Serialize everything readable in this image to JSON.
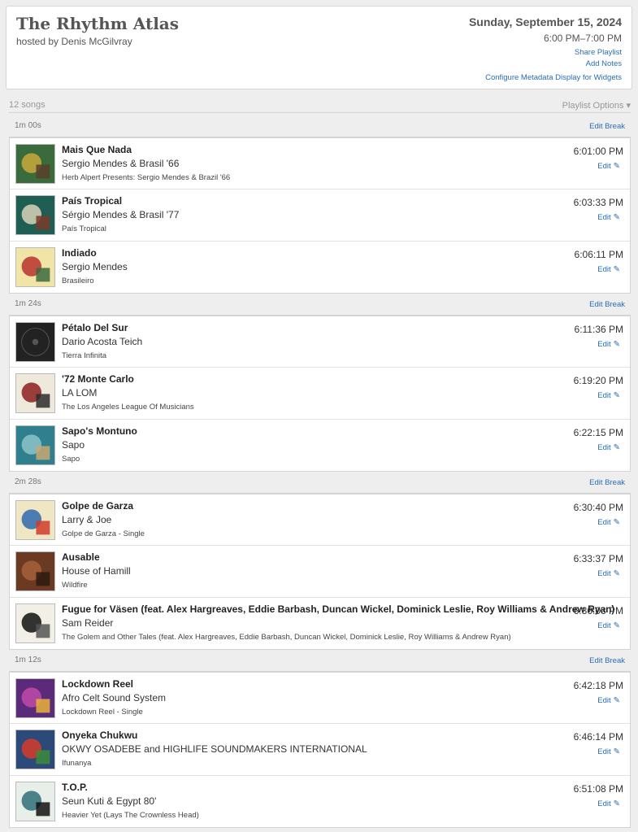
{
  "header": {
    "title": "The Rhythm Atlas",
    "host": "hosted by Denis McGilvray",
    "date": "Sunday, September 15, 2024",
    "time_range": "6:00 PM–7:00 PM",
    "links": {
      "share": "Share Playlist",
      "notes": "Add Notes",
      "config": "Configure Metadata Display for Widgets"
    }
  },
  "playlist": {
    "count_label": "12 songs",
    "options_label": "Playlist Options ▾",
    "edit_label": "Edit",
    "edit_break_label": "Edit Break"
  },
  "breaks": [
    {
      "duration": "1m 00s"
    },
    {
      "duration": "1m 24s"
    },
    {
      "duration": "2m 28s"
    },
    {
      "duration": "1m 12s"
    }
  ],
  "songs": [
    {
      "title": "Mais Que Nada",
      "artist": "Sergio Mendes & Brasil '66",
      "album": "Herb Alpert Presents: Sergio Mendes & Brazil '66",
      "time": "6:01:00 PM",
      "art_colors": [
        "#3a6b3d",
        "#c9a93a",
        "#5a3e2a"
      ]
    },
    {
      "title": "País Tropical",
      "artist": "Sérgio Mendes & Brasil '77",
      "album": "País Tropical",
      "time": "6:03:33 PM",
      "art_colors": [
        "#1f5e52",
        "#d8d2b8",
        "#7a3a2a"
      ]
    },
    {
      "title": "Indiado",
      "artist": "Sergio Mendes",
      "album": "Brasileiro",
      "time": "6:06:11 PM",
      "art_colors": [
        "#f0e4a6",
        "#b7322e",
        "#3c6a3e"
      ]
    },
    {
      "title": "Pétalo Del Sur",
      "artist": "Dario Acosta Teich",
      "album": "Tierra Infinita",
      "time": "6:11:36 PM",
      "art_colors": [
        "#222222",
        "#333333",
        "#444444"
      ]
    },
    {
      "title": "'72 Monte Carlo",
      "artist": "LA LOM",
      "album": "The Los Angeles League Of Musicians",
      "time": "6:19:20 PM",
      "art_colors": [
        "#efe9dc",
        "#8b1e1e",
        "#2b2b2b"
      ]
    },
    {
      "title": "Sapo's Montuno",
      "artist": "Sapo",
      "album": "Sapo",
      "time": "6:22:15 PM",
      "art_colors": [
        "#2f7f8f",
        "#8cc3c8",
        "#c7a872"
      ]
    },
    {
      "title": "Golpe de Garza",
      "artist": "Larry & Joe",
      "album": "Golpe de Garza - Single",
      "time": "6:30:40 PM",
      "art_colors": [
        "#efe6c4",
        "#2e6ab0",
        "#d13b2b"
      ]
    },
    {
      "title": "Ausable",
      "artist": "House of Hamill",
      "album": "Wildfire",
      "time": "6:33:37 PM",
      "art_colors": [
        "#6a3a22",
        "#a4623a",
        "#2e1a10"
      ]
    },
    {
      "title": "Fugue for Väsen (feat. Alex Hargreaves, Eddie Barbash, Duncan Wickel, Dominick Leslie, Roy Williams & Andrew Ryan)",
      "artist": "Sam Reider",
      "album": "The Golem and Other Tales (feat. Alex Hargreaves, Eddie Barbash, Duncan Wickel, Dominick Leslie, Roy Williams & Andrew Ryan)",
      "time": "6:36:03 PM",
      "art_colors": [
        "#f2efe6",
        "#111111",
        "#555555"
      ]
    },
    {
      "title": "Lockdown Reel",
      "artist": "Afro Celt Sound System",
      "album": "Lockdown Reel - Single",
      "time": "6:42:18 PM",
      "art_colors": [
        "#5b2a7a",
        "#c24aa8",
        "#e8b23a"
      ]
    },
    {
      "title": "Onyeka Chukwu",
      "artist": "OKWY OSADEBE and HIGHLIFE SOUNDMAKERS INTERNATIONAL",
      "album": "Ifunanya",
      "time": "6:46:14 PM",
      "art_colors": [
        "#2b4a7a",
        "#d83a2a",
        "#3d8a3a"
      ]
    },
    {
      "title": "T.O.P.",
      "artist": "Seun Kuti & Egypt 80'",
      "album": "Heavier Yet (Lays The Crownless Head)",
      "time": "6:51:08 PM",
      "art_colors": [
        "#e8efe9",
        "#2f6d78",
        "#101010"
      ]
    }
  ]
}
